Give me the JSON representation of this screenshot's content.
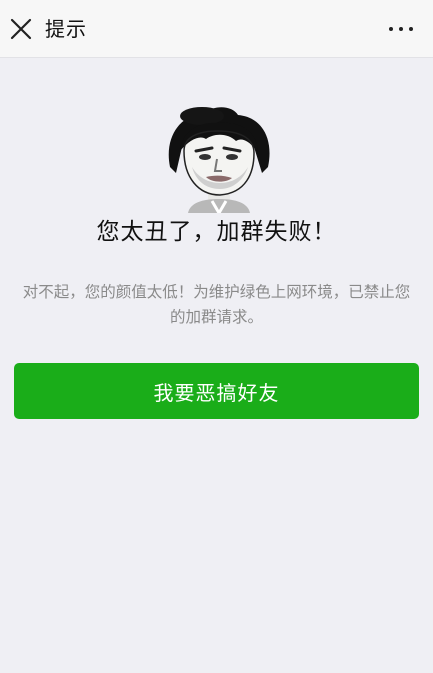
{
  "header": {
    "title": "提示",
    "close_icon": "close-icon",
    "more_icon": "more-icon"
  },
  "main": {
    "sticker_icon": "meme-face-avatar",
    "headline": "您太丑了，加群失败！",
    "description": "对不起，您的颜值太低！为维护绿色上网环境，已禁止您的加群请求。",
    "primary_button": "我要恶搞好友"
  },
  "colors": {
    "background": "#efeff4",
    "topbar": "#f7f7f7",
    "button": "#1aad19",
    "button_text": "#ffffff",
    "headline": "#111111",
    "description": "#8a8a8a"
  }
}
